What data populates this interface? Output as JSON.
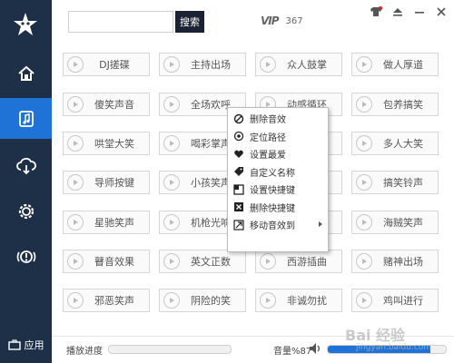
{
  "topbar": {
    "search_placeholder": "",
    "search_label": "搜索",
    "vip_badge": "VIP",
    "vip_count": "367"
  },
  "sidebar": {
    "items": [
      {
        "name": "home",
        "icon": "home-icon"
      },
      {
        "name": "music",
        "icon": "music-file-icon",
        "active": true
      },
      {
        "name": "cloud",
        "icon": "cloud-download-icon"
      },
      {
        "name": "settings",
        "icon": "gear-icon"
      },
      {
        "name": "alert",
        "icon": "alert-icon"
      }
    ],
    "app_label": "应用"
  },
  "sounds": [
    [
      "DJ搓碟",
      "主持出场",
      "众人鼓掌",
      "做人厚道"
    ],
    [
      "傻笑声音",
      "全场欢呼",
      "动感循环",
      "包养搞笑"
    ],
    [
      "哄堂大笑",
      "喝彩掌声",
      "",
      "多人大笑"
    ],
    [
      "导师按键",
      "小孩笑声",
      "",
      "搞笑铃声"
    ],
    [
      "星驰笑声",
      "机枪光响",
      "",
      "海贼笑声"
    ],
    [
      "瞽音效果",
      "英文正数",
      "西游插曲",
      "赌神出场"
    ],
    [
      "邪恶笑声",
      "阴险的笑",
      "非诚勿扰",
      "鸡叫进行"
    ]
  ],
  "context_menu": {
    "items": [
      {
        "label": "删除音效",
        "icon": "block-icon"
      },
      {
        "label": "定位路径",
        "icon": "locate-icon"
      },
      {
        "label": "设置最爱",
        "icon": "heart-icon"
      },
      {
        "label": "自定义名称",
        "icon": "tag-icon"
      },
      {
        "label": "设置快捷键",
        "icon": "shortcut-icon"
      },
      {
        "label": "删除快捷键",
        "icon": "delete-shortcut-icon"
      },
      {
        "label": "移动音效到",
        "icon": "move-icon",
        "submenu": true
      }
    ]
  },
  "bottombar": {
    "progress_label": "播放进度",
    "progress": 0.0,
    "volume_label": "音量%87",
    "volume": 0.87
  },
  "watermark": {
    "text": "Bai 经验",
    "sub": "jingyan.baidu.com"
  },
  "colors": {
    "sidebar_bg": "#1e3047",
    "accent": "#1f73d6",
    "search_btn": "#1b2233"
  }
}
